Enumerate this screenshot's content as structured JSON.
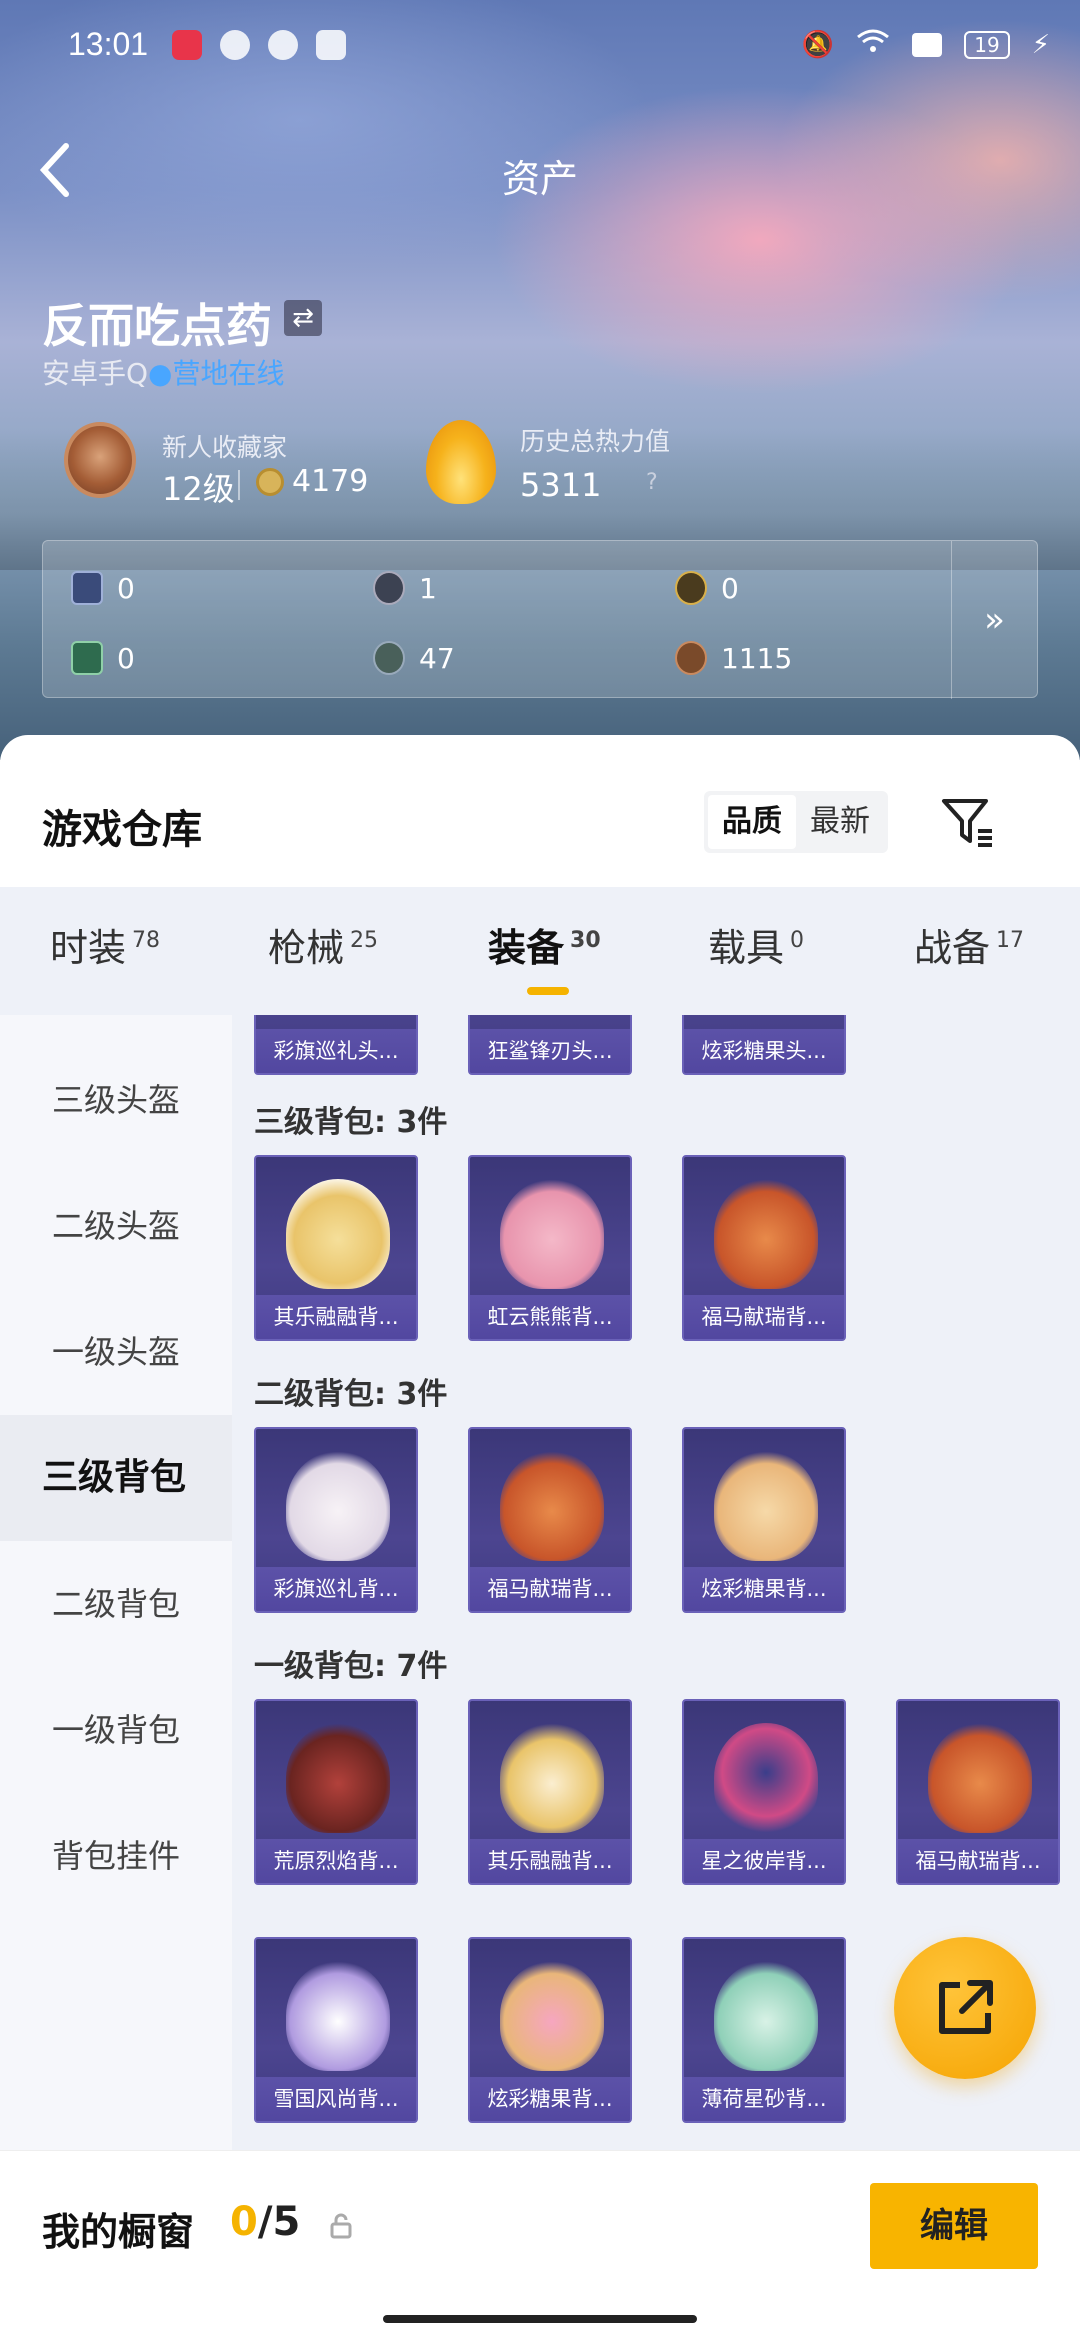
{
  "status_bar": {
    "time": "13:01",
    "battery": "19"
  },
  "nav": {
    "title": "资产"
  },
  "user": {
    "name": "反而吃点药",
    "platform": "安卓手Q",
    "status": "营地在线"
  },
  "collector": {
    "label": "新人收藏家",
    "level": "12级",
    "coins": "4179"
  },
  "heat": {
    "label": "历史总热力值",
    "value": "5311",
    "help": "?"
  },
  "stats": [
    "0",
    "1",
    "0",
    "0",
    "47",
    "1115"
  ],
  "warehouse": {
    "title": "游戏仓库",
    "sort_quality": "品质",
    "sort_latest": "最新"
  },
  "categories": [
    {
      "label": "时装",
      "count": "78"
    },
    {
      "label": "枪械",
      "count": "25"
    },
    {
      "label": "装备",
      "count": "30"
    },
    {
      "label": "载具",
      "count": "0"
    },
    {
      "label": "战备",
      "count": "17"
    }
  ],
  "side_menu": [
    "三级头盔",
    "二级头盔",
    "一级头盔",
    "三级背包",
    "二级背包",
    "一级背包",
    "背包挂件"
  ],
  "groups": {
    "top_items": [
      "彩旗巡礼头...",
      "狂鲨锋刃头...",
      "炫彩糖果头..."
    ],
    "g1": {
      "title": "三级背包: 3件",
      "items": [
        "其乐融融背...",
        "虹云熊熊背...",
        "福马献瑞背..."
      ]
    },
    "g2": {
      "title": "二级背包: 3件",
      "items": [
        "彩旗巡礼背...",
        "福马献瑞背...",
        "炫彩糖果背..."
      ]
    },
    "g3": {
      "title": "一级背包: 7件",
      "items": [
        "荒原烈焰背...",
        "其乐融融背...",
        "星之彼岸背...",
        "福马献瑞背...",
        "雪国风尚背...",
        "炫彩糖果背...",
        "薄荷星砂背..."
      ]
    }
  },
  "showcase": {
    "label": "我的橱窗",
    "current": "0",
    "total": "/5",
    "edit": "编辑"
  },
  "colors": {
    "accent": "#f5b300",
    "card": "#4c4590",
    "online": "#49a6ff"
  }
}
